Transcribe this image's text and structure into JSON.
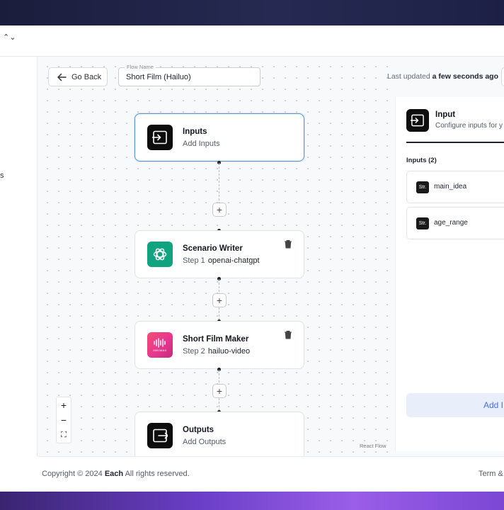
{
  "header": {
    "chevron_glyph": "⌃⌄"
  },
  "sidebar": {
    "fragment": "s"
  },
  "toolbar": {
    "go_back_label": "Go Back",
    "flow_name_label": "Flow Name",
    "flow_name_value": "Short Film (Hailuo)",
    "last_updated_prefix": "Last updated",
    "last_updated_value": "a few seconds ago"
  },
  "nodes": [
    {
      "title": "Inputs",
      "subtitle": "Add Inputs",
      "icon": "input-icon",
      "selected": true
    },
    {
      "title": "Scenario Writer",
      "step_label": "Step 1",
      "step_name": "openai-chatgpt",
      "icon": "openai-logo-icon"
    },
    {
      "title": "Short Film Maker",
      "step_label": "Step 2",
      "step_name": "hailuo-video",
      "icon": "minimax-logo-icon",
      "logo_text": "MINIMAX"
    },
    {
      "title": "Outputs",
      "subtitle": "Add Outputs",
      "icon": "output-icon"
    }
  ],
  "connector": {
    "plus_glyph": "+"
  },
  "zoom": {
    "in": "+",
    "out": "−",
    "fit": "⛶"
  },
  "canvas": {
    "attribution": "React Flow"
  },
  "side_panel": {
    "title": "Input",
    "description": "Configure inputs for y",
    "inputs_heading": "Inputs (2)",
    "type_badge": "Str.",
    "inputs": [
      {
        "name": "main_idea"
      },
      {
        "name": "age_range"
      }
    ],
    "add_button_label": "Add I"
  },
  "footer": {
    "copyright_prefix": "Copyright © 2024",
    "brand": "Each",
    "copyright_suffix": "All rights reserved.",
    "terms": "Term &"
  },
  "colors": {
    "accent_blue": "#5b9bd5",
    "openai_green": "#10a37f",
    "minimax_pink": "#e8368f",
    "add_button_bg": "#e8eefa",
    "add_button_text": "#4a6ed6"
  }
}
